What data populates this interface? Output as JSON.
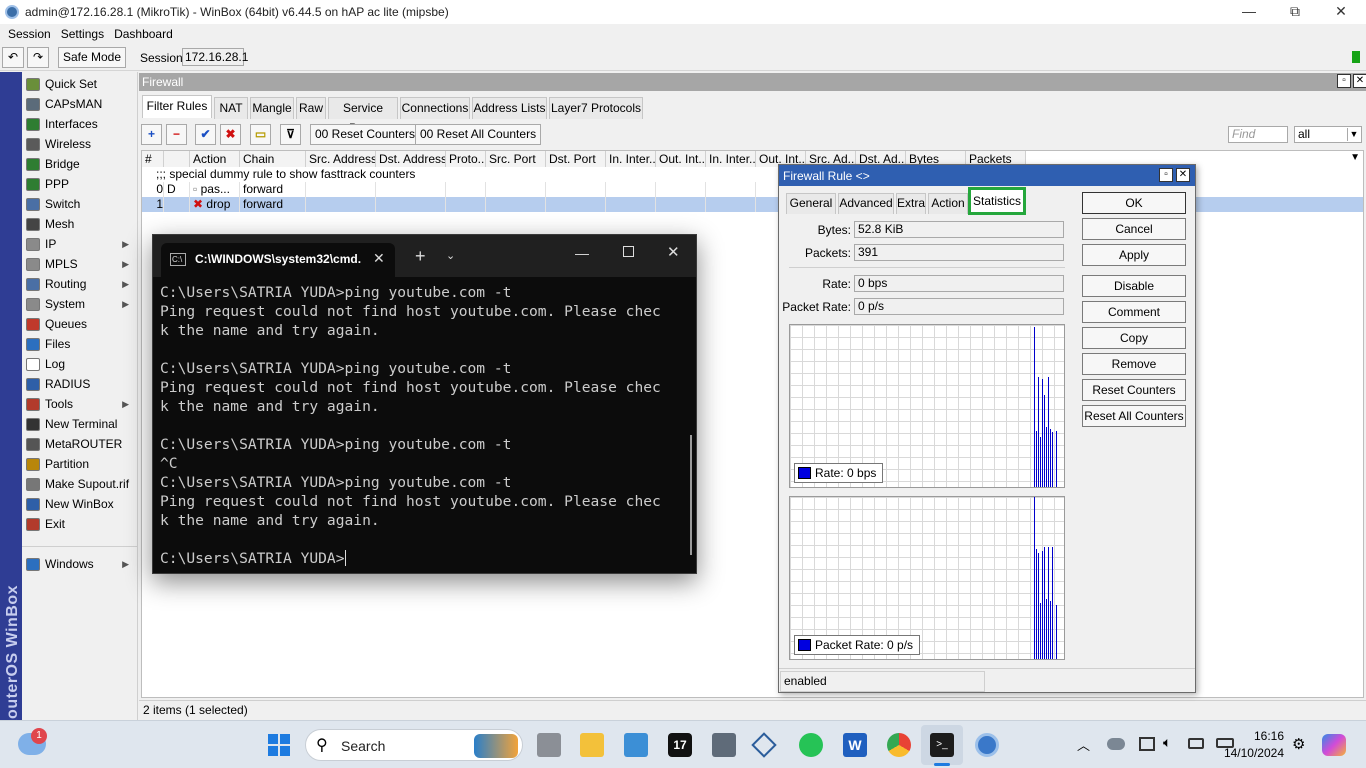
{
  "titlebar": {
    "title": "admin@172.16.28.1 (MikroTik) - WinBox (64bit) v6.44.5 on hAP ac lite (mipsbe)",
    "minimize": "—",
    "maximize": "⧉",
    "close": "✕"
  },
  "menubar": [
    "Session",
    "Settings",
    "Dashboard"
  ],
  "toolbar": {
    "undo": "↶",
    "redo": "↷",
    "safe_mode": "Safe Mode",
    "session_label": "Session:",
    "session_value": "172.16.28.1"
  },
  "brand": "RouterOS WinBox",
  "sidebar": {
    "items": [
      {
        "label": "Quick Set",
        "icon": "wand-icon",
        "color": "#6a8f3a",
        "arrow": false
      },
      {
        "label": "CAPsMAN",
        "icon": "capsman-icon",
        "color": "#5b6b7a",
        "arrow": false
      },
      {
        "label": "Interfaces",
        "icon": "interfaces-icon",
        "color": "#2e7d32",
        "arrow": false
      },
      {
        "label": "Wireless",
        "icon": "wireless-icon",
        "color": "#5a5a5a",
        "arrow": false
      },
      {
        "label": "Bridge",
        "icon": "bridge-icon",
        "color": "#2e7d32",
        "arrow": false
      },
      {
        "label": "PPP",
        "icon": "ppp-icon",
        "color": "#2e7d32",
        "arrow": false
      },
      {
        "label": "Switch",
        "icon": "switch-icon",
        "color": "#4a6fa5",
        "arrow": false
      },
      {
        "label": "Mesh",
        "icon": "mesh-icon",
        "color": "#444444",
        "arrow": false
      },
      {
        "label": "IP",
        "icon": "ip-icon",
        "color": "#8a8a8a",
        "arrow": true
      },
      {
        "label": "MPLS",
        "icon": "mpls-icon",
        "color": "#8a8a8a",
        "arrow": true
      },
      {
        "label": "Routing",
        "icon": "routing-icon",
        "color": "#4a6fa5",
        "arrow": true
      },
      {
        "label": "System",
        "icon": "gear-icon",
        "color": "#8a8a8a",
        "arrow": true
      },
      {
        "label": "Queues",
        "icon": "queues-icon",
        "color": "#c0392b",
        "arrow": false
      },
      {
        "label": "Files",
        "icon": "folder-icon",
        "color": "#2c6fbf",
        "arrow": false
      },
      {
        "label": "Log",
        "icon": "log-icon",
        "color": "#ffffff",
        "arrow": false
      },
      {
        "label": "RADIUS",
        "icon": "radius-icon",
        "color": "#2e5fa8",
        "arrow": false
      },
      {
        "label": "Tools",
        "icon": "tools-icon",
        "color": "#b23b2b",
        "arrow": true
      },
      {
        "label": "New Terminal",
        "icon": "terminal-icon",
        "color": "#333333",
        "arrow": false
      },
      {
        "label": "MetaROUTER",
        "icon": "metarouter-icon",
        "color": "#555555",
        "arrow": false
      },
      {
        "label": "Partition",
        "icon": "partition-icon",
        "color": "#b8860b",
        "arrow": false
      },
      {
        "label": "Make Supout.rif",
        "icon": "supout-icon",
        "color": "#777777",
        "arrow": false
      },
      {
        "label": "New WinBox",
        "icon": "winbox-icon",
        "color": "#2e5fa8",
        "arrow": false
      },
      {
        "label": "Exit",
        "icon": "exit-icon",
        "color": "#b23b2b",
        "arrow": false
      },
      {
        "label": "Windows",
        "icon": "windows-icon",
        "color": "#2c6fbf",
        "arrow": true
      }
    ]
  },
  "firewall": {
    "title": "Firewall",
    "tabs": [
      "Filter Rules",
      "NAT",
      "Mangle",
      "Raw",
      "Service Ports",
      "Connections",
      "Address Lists",
      "Layer7 Protocols"
    ],
    "buttons": {
      "add": "+",
      "remove": "−",
      "enable": "✔",
      "disable": "✖",
      "comment": "▭",
      "filter": "⊽",
      "reset": "00 Reset Counters",
      "reset_all": "00 Reset All Counters"
    },
    "find_placeholder": "Find",
    "find_scope": "all",
    "columns": [
      "#",
      "",
      "Action",
      "Chain",
      "Src. Address",
      "Dst. Address",
      "Proto...",
      "Src. Port",
      "Dst. Port",
      "In. Inter...",
      "Out. Int...",
      "In. Inter...",
      "Out. Int...",
      "Src. Ad...",
      "Dst. Ad...",
      "Bytes",
      "Packets"
    ],
    "comment_row": ";;; special dummy rule to show fasttrack counters",
    "rows": [
      {
        "num": "0",
        "flag": "D",
        "action": "pas...",
        "chain": "forward"
      },
      {
        "num": "1",
        "flag": "",
        "action": "drop",
        "chain": "forward"
      }
    ],
    "status": "2 items (1 selected)"
  },
  "rule_dialog": {
    "title": "Firewall Rule <>",
    "tabs": [
      "General",
      "Advanced",
      "Extra",
      "Action",
      "Statistics"
    ],
    "fields": [
      {
        "label": "Bytes:",
        "value": "52.8 KiB"
      },
      {
        "label": "Packets:",
        "value": "391"
      },
      {
        "label": "Rate:",
        "value": "0 bps"
      },
      {
        "label": "Packet Rate:",
        "value": "0 p/s"
      }
    ],
    "buttons": [
      "OK",
      "Cancel",
      "Apply",
      "Disable",
      "Comment",
      "Copy",
      "Remove",
      "Reset Counters",
      "Reset All Counters"
    ],
    "graph1_legend": "Rate:  0 bps",
    "graph2_legend": "Packet Rate:  0 p/s",
    "status": "enabled",
    "legend_color": "#0000e0"
  },
  "cmd": {
    "tab_title": "C:\\WINDOWS\\system32\\cmd.",
    "lines": "C:\\Users\\SATRIA YUDA>ping youtube.com -t\nPing request could not find host youtube.com. Please chec\nk the name and try again.\n\nC:\\Users\\SATRIA YUDA>ping youtube.com -t\nPing request could not find host youtube.com. Please chec\nk the name and try again.\n\nC:\\Users\\SATRIA YUDA>ping youtube.com -t\n^C\nC:\\Users\\SATRIA YUDA>ping youtube.com -t\nPing request could not find host youtube.com. Please chec\nk the name and try again.\n\nC:\\Users\\SATRIA YUDA>"
  },
  "taskbar": {
    "search_label": "Search",
    "notification_count": "1",
    "time": "16:16",
    "date": "14/10/2024",
    "apps": [
      "start-icon",
      "search-icon",
      "task-view-icon",
      "file-explorer-icon",
      "control-panel-icon",
      "tradingview-icon",
      "snipping-icon",
      "virtualbox-icon",
      "whatsapp-icon",
      "word-icon",
      "chrome-icon",
      "terminal-icon",
      "winbox-icon"
    ]
  }
}
